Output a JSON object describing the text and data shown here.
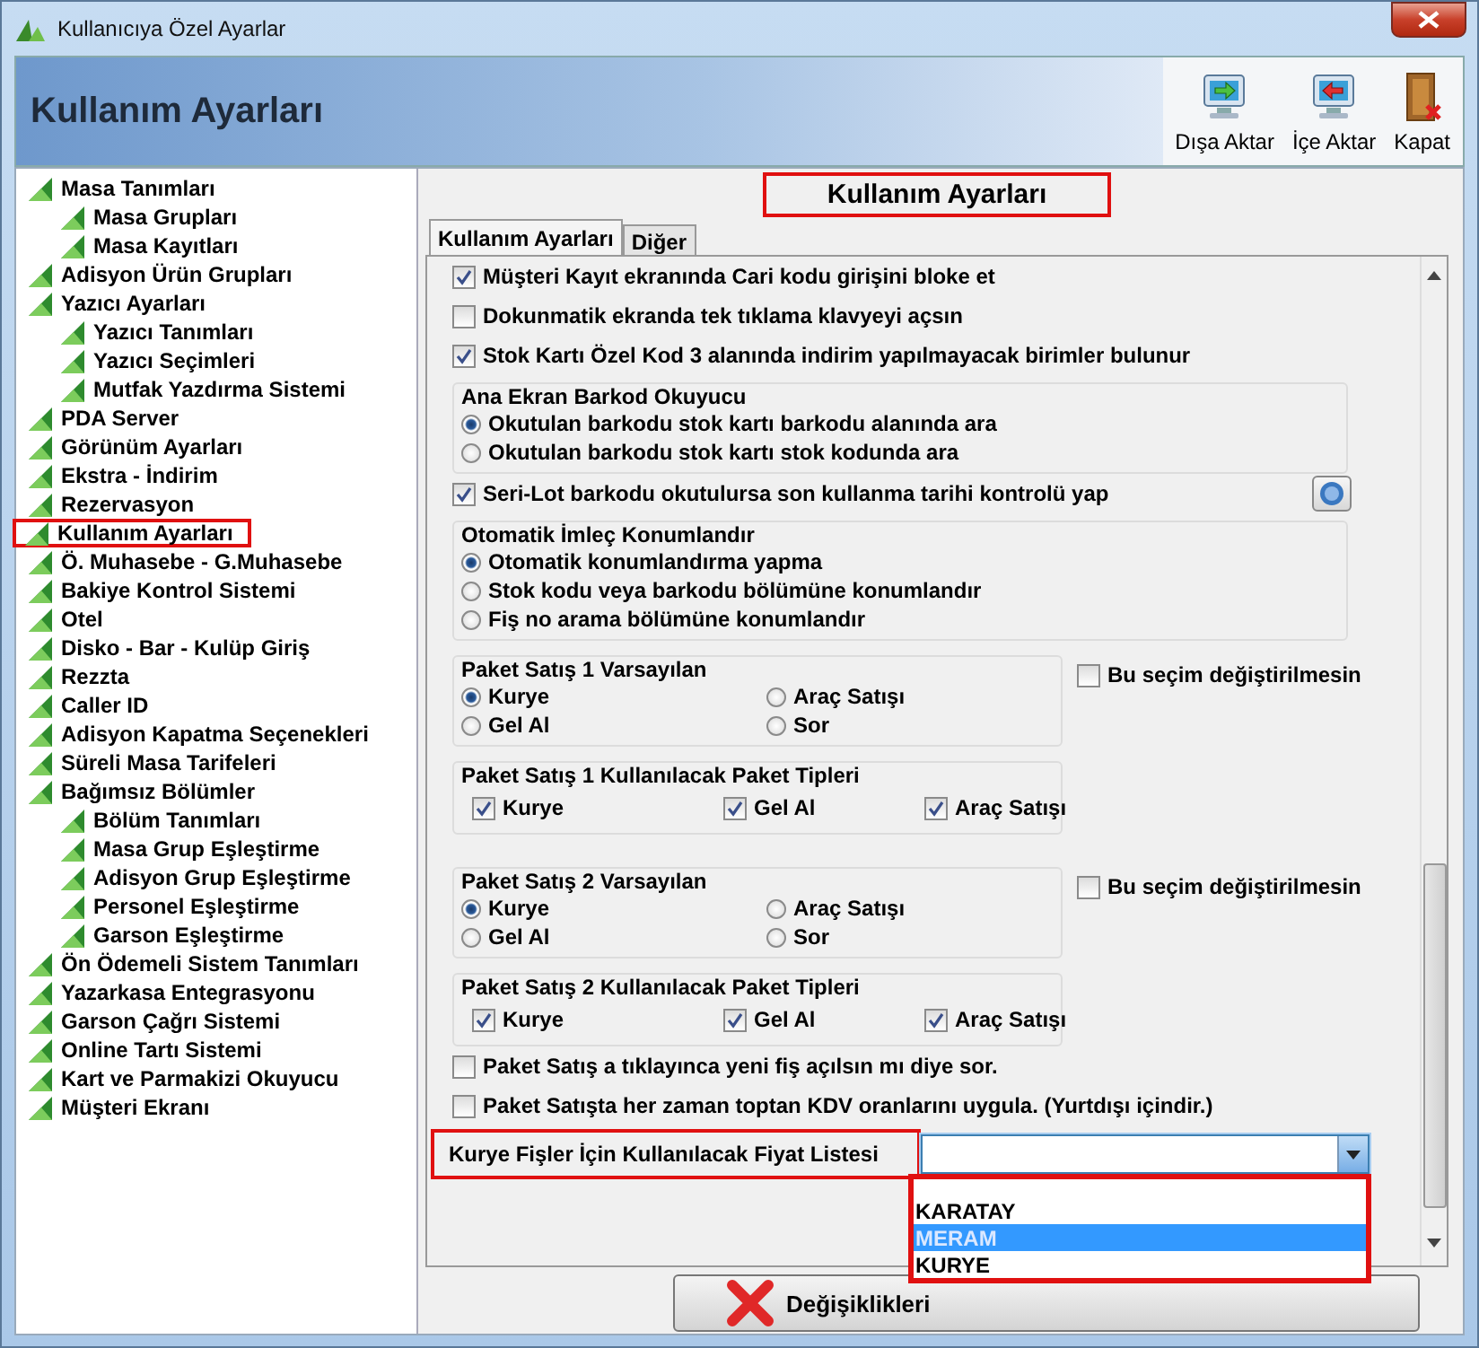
{
  "window": {
    "title": "Kullanıcıya Özel Ayarlar"
  },
  "header": {
    "title": "Kullanım Ayarları"
  },
  "toolbar": [
    {
      "kind": "export",
      "label": "Dışa Aktar"
    },
    {
      "kind": "import",
      "label": "İçe Aktar"
    },
    {
      "kind": "close",
      "label": "Kapat"
    }
  ],
  "tree": [
    {
      "label": "Masa Tanımları",
      "highlighted": false,
      "children": [
        {
          "label": "Masa Grupları",
          "highlighted": false
        },
        {
          "label": "Masa Kayıtları",
          "highlighted": false
        }
      ]
    },
    {
      "label": "Adisyon Ürün Grupları",
      "highlighted": false
    },
    {
      "label": "Yazıcı Ayarları",
      "highlighted": false,
      "children": [
        {
          "label": "Yazıcı Tanımları",
          "highlighted": false
        },
        {
          "label": "Yazıcı Seçimleri",
          "highlighted": false
        },
        {
          "label": "Mutfak Yazdırma Sistemi",
          "highlighted": false
        }
      ]
    },
    {
      "label": "PDA Server",
      "highlighted": false
    },
    {
      "label": "Görünüm Ayarları",
      "highlighted": false
    },
    {
      "label": "Ekstra - İndirim",
      "highlighted": false
    },
    {
      "label": "Rezervasyon",
      "highlighted": false
    },
    {
      "label": "Kullanım Ayarları",
      "highlighted": true
    },
    {
      "label": "Ö. Muhasebe - G.Muhasebe",
      "highlighted": false
    },
    {
      "label": "Bakiye Kontrol Sistemi",
      "highlighted": false
    },
    {
      "label": "Otel",
      "highlighted": false
    },
    {
      "label": "Disko - Bar - Kulüp Giriş",
      "highlighted": false
    },
    {
      "label": "Rezzta",
      "highlighted": false
    },
    {
      "label": "Caller ID",
      "highlighted": false
    },
    {
      "label": "Adisyon Kapatma Seçenekleri",
      "highlighted": false
    },
    {
      "label": "Süreli Masa Tarifeleri",
      "highlighted": false
    },
    {
      "label": "Bağımsız Bölümler",
      "highlighted": false,
      "children": [
        {
          "label": "Bölüm Tanımları",
          "highlighted": false
        },
        {
          "label": "Masa Grup Eşleştirme",
          "highlighted": false
        },
        {
          "label": "Adisyon Grup Eşleştirme",
          "highlighted": false
        },
        {
          "label": "Personel Eşleştirme",
          "highlighted": false
        },
        {
          "label": "Garson Eşleştirme",
          "highlighted": false
        }
      ]
    },
    {
      "label": "Ön Ödemeli Sistem Tanımları",
      "highlighted": false
    },
    {
      "label": "Yazarkasa Entegrasyonu",
      "highlighted": false
    },
    {
      "label": "Garson Çağrı Sistemi",
      "highlighted": false
    },
    {
      "label": "Online Tartı Sistemi",
      "highlighted": false
    },
    {
      "label": "Kart ve Parmakizi Okuyucu",
      "highlighted": false
    },
    {
      "label": "Müşteri Ekranı",
      "highlighted": false
    }
  ],
  "panel": {
    "title": "Kullanım Ayarları",
    "highlighted": true
  },
  "tabs": [
    {
      "label": "Kullanım Ayarları",
      "selected": true
    },
    {
      "label": "Diğer",
      "selected": false
    }
  ],
  "settings": [
    {
      "kind": "checkbox",
      "label": "Müşteri Kayıt ekranında Cari kodu girişini bloke et",
      "checked": true
    },
    {
      "kind": "checkbox",
      "label": "Dokunmatik ekranda tek tıklama klavyeyi açsın",
      "checked": false
    },
    {
      "kind": "checkbox",
      "label": "Stok Kartı Özel Kod 3 alanında indirim yapılmayacak birimler bulunur",
      "checked": true
    },
    {
      "kind": "radio_group",
      "title": "Ana Ekran Barkod Okuyucu",
      "options": [
        {
          "label": "Okutulan barkodu stok kartı barkodu alanında ara",
          "selected": true
        },
        {
          "label": "Okutulan barkodu stok kartı stok kodunda ara",
          "selected": false
        }
      ]
    },
    {
      "kind": "checkbox_help",
      "label": "Seri-Lot barkodu okutulursa son kullanma tarihi kontrolü yap",
      "checked": true
    },
    {
      "kind": "radio_group",
      "title": "Otomatik İmleç Konumlandır",
      "options": [
        {
          "label": "Otomatik konumlandırma yapma",
          "selected": true
        },
        {
          "label": "Stok kodu veya barkodu bölümüne konumlandır",
          "selected": false
        },
        {
          "label": "Fiş no arama bölümüne konumlandır",
          "selected": false
        }
      ]
    },
    {
      "kind": "radio_grid",
      "title": "Paket Satış 1 Varsayılan",
      "options": [
        {
          "label": "Kurye",
          "selected": true
        },
        {
          "label": "Araç Satışı",
          "selected": false
        },
        {
          "label": "Gel Al",
          "selected": false
        },
        {
          "label": "Sor",
          "selected": false
        }
      ],
      "side_checkbox": {
        "label": "Bu seçim değiştirilmesin",
        "checked": false
      }
    },
    {
      "kind": "checkbox_group",
      "title": "Paket Satış 1 Kullanılacak Paket Tipleri",
      "options": [
        {
          "label": "Kurye",
          "checked": true
        },
        {
          "label": "Gel Al",
          "checked": true
        },
        {
          "label": "Araç Satışı",
          "checked": true
        }
      ]
    },
    {
      "kind": "radio_grid",
      "title": "Paket Satış 2 Varsayılan",
      "options": [
        {
          "label": "Kurye",
          "selected": true
        },
        {
          "label": "Araç Satışı",
          "selected": false
        },
        {
          "label": "Gel Al",
          "selected": false
        },
        {
          "label": "Sor",
          "selected": false
        }
      ],
      "side_checkbox": {
        "label": "Bu seçim değiştirilmesin",
        "checked": false
      }
    },
    {
      "kind": "checkbox_group",
      "title": "Paket Satış 2 Kullanılacak Paket Tipleri",
      "options": [
        {
          "label": "Kurye",
          "checked": true
        },
        {
          "label": "Gel Al",
          "checked": true
        },
        {
          "label": "Araç Satışı",
          "checked": true
        }
      ]
    },
    {
      "kind": "checkbox",
      "label": "Paket Satış a tıklayınca yeni fiş açılsın mı diye sor.",
      "checked": false
    },
    {
      "kind": "checkbox",
      "label": "Paket Satışta her zaman toptan KDV oranlarını uygula. (Yurtdışı içindir.)",
      "checked": false
    }
  ],
  "price_list": {
    "label": "Kurye Fişler İçin Kullanılacak Fiyat Listesi",
    "highlighted": true,
    "expanded": true,
    "options": [
      {
        "label": "KARATAY",
        "selected": false
      },
      {
        "label": "MERAM",
        "selected": true
      },
      {
        "label": "KURYE",
        "selected": false
      }
    ]
  },
  "footer_button": {
    "label": "Değişiklikleri"
  }
}
